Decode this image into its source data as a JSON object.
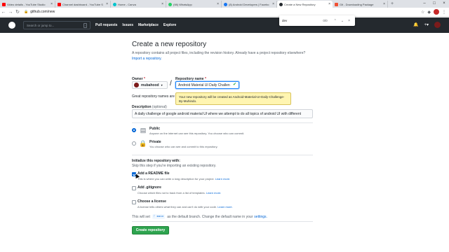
{
  "browser": {
    "tabs": [
      {
        "label": "Video details - YouTube Studio",
        "color": "#ff0000"
      },
      {
        "label": "Channel dashboard - YouTube S",
        "color": "#ff0000"
      },
      {
        "label": "Home - Canva",
        "color": "#00c4cc"
      },
      {
        "label": "(98) WhatsApp",
        "color": "#25d366"
      },
      {
        "label": "(8) Android Developers | Facebo",
        "color": "#1877f2"
      },
      {
        "label": "Create a New Repository",
        "color": "#24292e"
      },
      {
        "label": "Git - Downloading Package",
        "color": "#f05033"
      }
    ],
    "url": "github.com/new",
    "find": {
      "query": "dev",
      "count": "0/0"
    }
  },
  "github": {
    "search_placeholder": "Search or jump to...",
    "search_key": "/",
    "nav": [
      "Pull requests",
      "Issues",
      "Marketplace",
      "Explore"
    ]
  },
  "form": {
    "title": "Create a new repository",
    "subtitle": "A repository contains all project files, including the revision history. Already have a project repository elsewhere?",
    "import_link": "Import a repository.",
    "owner_label": "Owner",
    "owner_value": "mubahood",
    "repo_label": "Repository name",
    "required_mark": "*",
    "repo_value": "Android Material UI Daily Challen",
    "great_text": "Great repository names are",
    "tooltip": "Your new repository will be created as Android-Material-UI-Daily-Challenge-By-Muhindo.",
    "desc_label": "Description",
    "desc_optional": "(optional)",
    "desc_value": "A daily challenge of google android material UI where we attempt to do all topics of android UI with different",
    "visibility": {
      "public_title": "Public",
      "public_desc": "Anyone on the internet can see this repository. You choose who can commit.",
      "private_title": "Private",
      "private_desc": "You choose who can see and commit to this repository."
    },
    "init_title": "Initialize this repository with:",
    "init_sub": "Skip this step if you're importing an existing repository.",
    "readme_title": "Add a README file",
    "readme_desc": "This is where you can write a long description for your project.",
    "readme_link": "Learn more.",
    "gitignore_title": "Add .gitignore",
    "gitignore_desc": "Choose which files not to track from a list of templates.",
    "gitignore_link": "Learn more.",
    "license_title": "Choose a license",
    "license_desc": "A license tells others what they can and can't do with your code.",
    "license_link": "Learn more.",
    "branch_pre": "This will set",
    "branch_name": "main",
    "branch_post": "as the default branch. Change the default name in your",
    "branch_link": "settings.",
    "create_button": "Create repository"
  }
}
